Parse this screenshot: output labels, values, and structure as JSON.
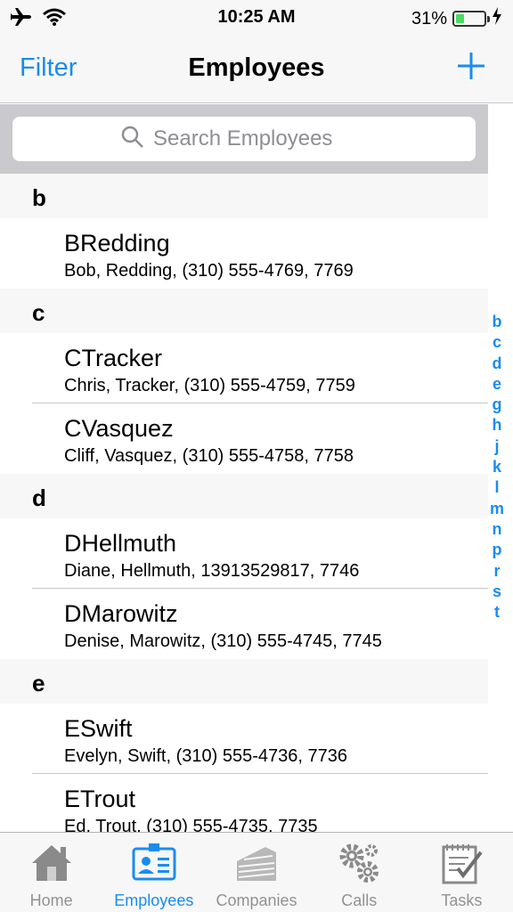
{
  "status": {
    "time": "10:25 AM",
    "battery_percent_label": "31%",
    "battery_level": 0.31
  },
  "nav": {
    "left_label": "Filter",
    "title": "Employees",
    "right_icon": "plus-icon"
  },
  "search": {
    "placeholder": "Search Employees"
  },
  "sections": [
    {
      "letter": "b",
      "rows": [
        {
          "title": "BRedding",
          "subtitle": "Bob, Redding, (310) 555-4769, 7769"
        }
      ]
    },
    {
      "letter": "c",
      "rows": [
        {
          "title": "CTracker",
          "subtitle": "Chris, Tracker, (310) 555-4759, 7759"
        },
        {
          "title": "CVasquez",
          "subtitle": "Cliff, Vasquez, (310) 555-4758, 7758"
        }
      ]
    },
    {
      "letter": "d",
      "rows": [
        {
          "title": "DHellmuth",
          "subtitle": "Diane, Hellmuth, 13913529817, 7746"
        },
        {
          "title": "DMarowitz",
          "subtitle": "Denise, Marowitz, (310) 555-4745, 7745"
        }
      ]
    },
    {
      "letter": "e",
      "rows": [
        {
          "title": "ESwift",
          "subtitle": "Evelyn, Swift, (310) 555-4736, 7736"
        },
        {
          "title": "ETrout",
          "subtitle": "Ed, Trout, (310) 555-4735, 7735"
        }
      ]
    }
  ],
  "index_letters": [
    "b",
    "c",
    "d",
    "e",
    "g",
    "h",
    "j",
    "k",
    "l",
    "m",
    "n",
    "p",
    "r",
    "s",
    "t"
  ],
  "tabs": [
    {
      "label": "Home",
      "icon": "home-icon",
      "active": false
    },
    {
      "label": "Employees",
      "icon": "id-card-icon",
      "active": true
    },
    {
      "label": "Companies",
      "icon": "building-icon",
      "active": false
    },
    {
      "label": "Calls",
      "icon": "gears-icon",
      "active": false
    },
    {
      "label": "Tasks",
      "icon": "notepad-icon",
      "active": false
    }
  ],
  "colors": {
    "accent": "#1a8cf0",
    "inactive": "#929292",
    "section_bg": "#f7f7f7",
    "search_bg": "#c9c9ce",
    "battery": "#4cd964"
  }
}
